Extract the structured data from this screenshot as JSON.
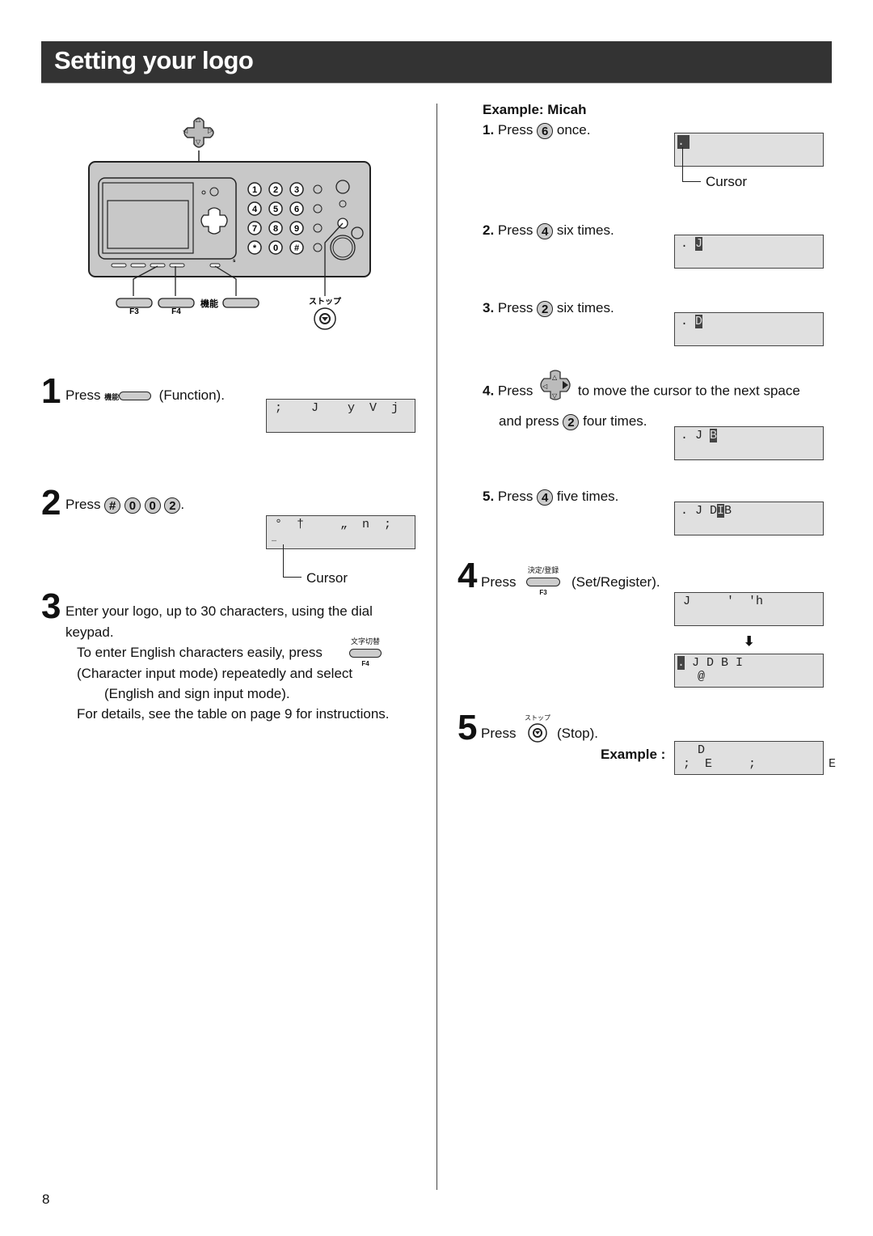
{
  "header": {
    "title": "Setting your logo"
  },
  "page_number": "8",
  "device": {
    "keypad": [
      "1",
      "2",
      "3",
      "4",
      "5",
      "6",
      "7",
      "8",
      "9",
      "*",
      "0",
      "#"
    ],
    "labels": {
      "f3": "F3",
      "f4": "F4",
      "function_jp": "機能",
      "stop_jp": "ストップ"
    }
  },
  "steps": {
    "s1": {
      "num": "1",
      "press": "Press",
      "key_jp": "機能",
      "suffix": "(Function).",
      "lcd": {
        "row1": ";    J    y  V  j",
        "row2": ""
      }
    },
    "s2": {
      "num": "2",
      "press": "Press",
      "keys": [
        "#",
        "0",
        "0",
        "2"
      ],
      "suffix": ".",
      "lcd": {
        "row1": "°  †     „  n  ;",
        "row2": "…"
      },
      "cursor_label": "Cursor"
    },
    "s3": {
      "num": "3",
      "line1": "Enter your logo, up to 30 characters, using the dial",
      "line2": "keypad.",
      "line3": "To enter English characters easily, press",
      "key_jp": "文字切替",
      "key_f": "F4",
      "line4": "(Character input mode) repeatedly and select",
      "line5": "(English and sign input mode).",
      "line6": "For details, see the table on page 9 for instructions."
    },
    "s4": {
      "num": "4",
      "press": "Press",
      "key_jp": "決定/登録",
      "key_f": "F3",
      "suffix": "(Set/Register).",
      "lcd1": {
        "row1": "J     '  'h",
        "row2": ""
      },
      "arrow": "⬇",
      "lcd2": {
        "cursor": ".",
        "row1": " J D B I",
        "row2": "  @"
      }
    },
    "s5": {
      "num": "5",
      "press": "Press",
      "key_jp": "ストップ",
      "suffix": "(Stop).",
      "example_label": "Example :",
      "lcd": {
        "row1": "  D",
        "row2": ";  E     ;          E"
      }
    }
  },
  "example": {
    "title": "Example: Micah",
    "items": [
      {
        "num": "1.",
        "press": "Press",
        "key": "6",
        "times": "once.",
        "lcd_cursor": ".",
        "lcd_rest": "",
        "cursor_label": "Cursor"
      },
      {
        "num": "2.",
        "press": "Press",
        "key": "4",
        "times": "six times.",
        "lcd_pre": ". ",
        "lcd_cursor": "J"
      },
      {
        "num": "3.",
        "press": "Press",
        "key": "2",
        "times": "six times.",
        "lcd_pre": ". ",
        "lcd_cursor": "D"
      },
      {
        "num": "4.",
        "press": "Press",
        "text1": "to move the cursor to the next space",
        "text2": "and press",
        "key": "2",
        "times": "four times.",
        "lcd_pre": ". J ",
        "lcd_cursor": "B"
      },
      {
        "num": "5.",
        "press": "Press",
        "key": "4",
        "times": "five times.",
        "lcd_pre": ". J D",
        "lcd_cursor": "I",
        "lcd_post": "B"
      }
    ]
  }
}
